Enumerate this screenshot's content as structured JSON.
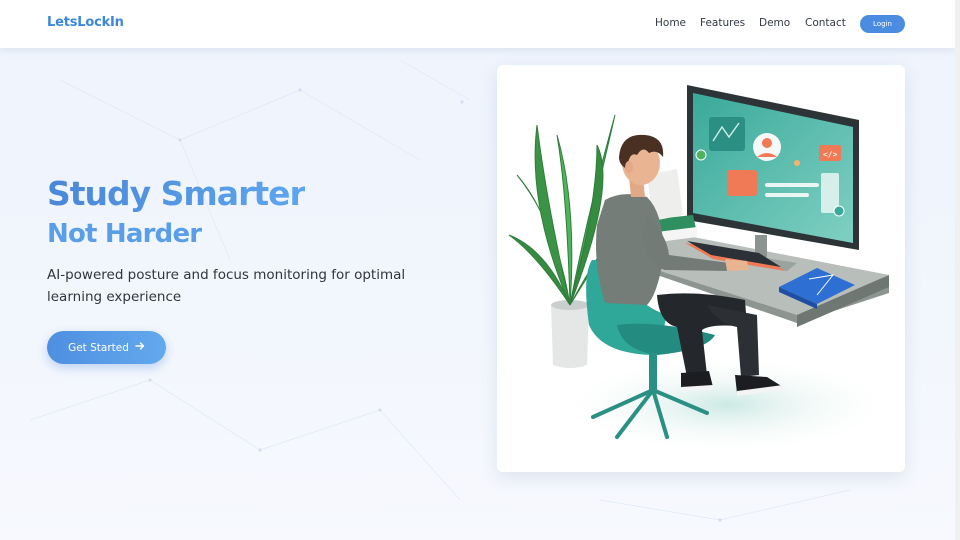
{
  "brand": {
    "name": "LetsLockIn"
  },
  "nav": {
    "home": "Home",
    "features": "Features",
    "demo": "Demo",
    "contact": "Contact",
    "login": "Login"
  },
  "hero": {
    "title_line1": "Study Smarter",
    "title_line2": "Not Harder",
    "subtitle": "AI-powered posture and focus monitoring for optimal learning experience",
    "cta_label": "Get Started",
    "cta_icon": "arrow-right-icon"
  },
  "illustration": {
    "description_icon": "student-at-desk-illustration",
    "screen_tag": "</>"
  },
  "colors": {
    "brand_blue": "#3b87dc",
    "accent_teal": "#2fa89a",
    "accent_orange": "#f07a55",
    "button_blue": "#4a8de0"
  }
}
